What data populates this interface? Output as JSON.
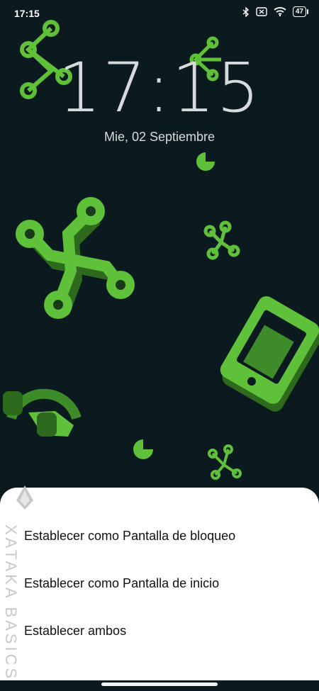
{
  "status_bar": {
    "time": "17:15",
    "battery": "47",
    "icons": [
      "bluetooth-icon",
      "close-box-icon",
      "wifi-icon",
      "battery-icon"
    ]
  },
  "lock_screen": {
    "clock": "17:15",
    "date": "Mie, 02 Septiembre"
  },
  "action_sheet": {
    "items": [
      "Establecer como Pantalla de bloqueo",
      "Establecer como Pantalla de inicio",
      "Establecer ambos"
    ]
  },
  "watermark": {
    "text": "XATAKA BASICS"
  },
  "colors": {
    "background": "#0b1a1f",
    "accent_green": "#5fc13a",
    "sheet": "#ffffff"
  }
}
